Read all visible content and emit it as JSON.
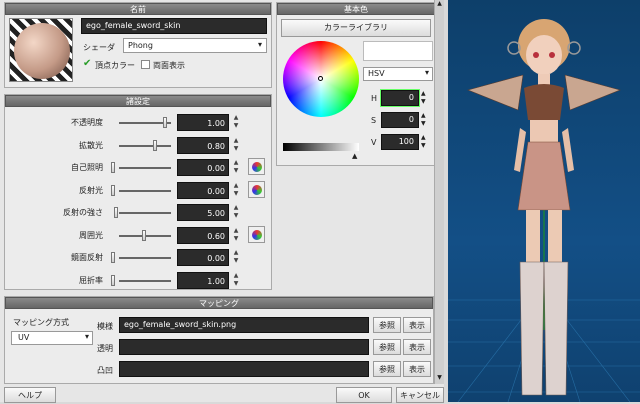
{
  "material": {
    "header": "名前",
    "name": "ego_female_sword_skin",
    "shader_label": "シェーダ",
    "shader_value": "Phong",
    "vertex_color_label": "頂点カラー",
    "double_sided_label": "両面表示"
  },
  "properties": {
    "header": "諸設定",
    "rows": [
      {
        "label": "不透明度",
        "value": "1.00",
        "pos": 1.0,
        "palette": false
      },
      {
        "label": "拡散光",
        "value": "0.80",
        "pos": 0.8,
        "palette": false
      },
      {
        "label": "自己照明",
        "value": "0.00",
        "pos": 0.0,
        "palette": true
      },
      {
        "label": "反射光",
        "value": "0.00",
        "pos": 0.0,
        "palette": true
      },
      {
        "label": "反射の強さ",
        "value": "5.00",
        "pos": 0.05,
        "palette": false
      },
      {
        "label": "周囲光",
        "value": "0.60",
        "pos": 0.6,
        "palette": true
      },
      {
        "label": "鏡面反射",
        "value": "0.00",
        "pos": 0.0,
        "palette": false
      },
      {
        "label": "屈折率",
        "value": "1.00",
        "pos": 0.0,
        "palette": false
      }
    ]
  },
  "color": {
    "header": "基本色",
    "library_label": "カラーライブラリ",
    "mode": "HSV",
    "h_label": "H",
    "h_value": "0",
    "s_label": "S",
    "s_value": "0",
    "v_label": "V",
    "v_value": "100",
    "swatch": "#ffffff"
  },
  "mapping": {
    "header": "マッピング",
    "method_label": "マッピング方式",
    "method_value": "UV",
    "rows": [
      {
        "label": "模様",
        "file": "ego_female_sword_skin.png",
        "ref": "参照",
        "show": "表示"
      },
      {
        "label": "透明",
        "file": "",
        "ref": "参照",
        "show": "表示"
      },
      {
        "label": "凸凹",
        "file": "",
        "ref": "参照",
        "show": "表示"
      }
    ]
  },
  "footer": {
    "help": "ヘルプ",
    "ok": "OK",
    "cancel": "キャンセル"
  }
}
